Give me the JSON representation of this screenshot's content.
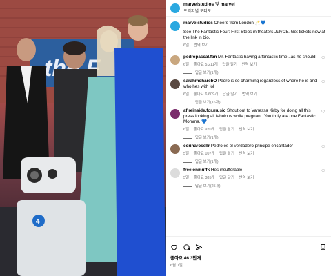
{
  "header": {
    "account": "marvelstudios",
    "joiner": "및",
    "collab": "marvel",
    "audio": "오리지널 오디오"
  },
  "caption": {
    "user": "marvelstudios",
    "first_line": "Cheers from London 🥂💙",
    "body": "See The Fantastic Four: First Steps in theaters July 25. Get tickets now at the link in bio.",
    "age": "6일",
    "translate": "번역 보기"
  },
  "comments": [
    {
      "user": "pedropascal.fan",
      "text": "Mr. Fantastic having a fantastic time...as he should",
      "age": "6일",
      "likes": "좋아요 5,211개",
      "reply": "답글 달기",
      "translate": "번역 보기",
      "replies": "답글 보기(1개)",
      "avatar_color": "#c9a77f"
    },
    {
      "user": "sarahmoharebO",
      "text": "Pedro is so charming regardless of where he is and who hes with lol",
      "age": "6일",
      "likes": "좋아요 6,609개",
      "reply": "답글 달기",
      "translate": "번역 보기",
      "replies": "답글 보기(16개)",
      "avatar_color": "#5a4a42"
    },
    {
      "user": "afireinside.for.music",
      "text": "Shout out to Vanessa Kirby for doing all this press looking all fabulous while pregnant. You truly are one Fantastic Momma. 💙",
      "age": "6일",
      "likes": "좋아요 920개",
      "reply": "답글 달기",
      "translate": "번역 보기",
      "replies": "답글 보기(1개)",
      "avatar_color": "#7a2c6b"
    },
    {
      "user": "corinarosellr",
      "text": "Pedro es el verdadero principe encantador",
      "age": "5일",
      "likes": "좋아요 107개",
      "reply": "답글 달기",
      "translate": "번역 보기",
      "replies": "답글 보기(1개)",
      "avatar_color": "#8a6a52"
    },
    {
      "user": "freelonmuffk",
      "text": "Hes insufferable",
      "age": "5일",
      "likes": "좋아요 385개",
      "reply": "답글 달기",
      "translate": "번역 보기",
      "replies": "답글 보기(25개)",
      "avatar_color": "#dcdcdc"
    }
  ],
  "footer": {
    "likes": "좋아요 46.3만개",
    "date": "6월 1일"
  },
  "colors": {
    "brand_avatar": "#2aa8e0",
    "muted": "#737373"
  }
}
